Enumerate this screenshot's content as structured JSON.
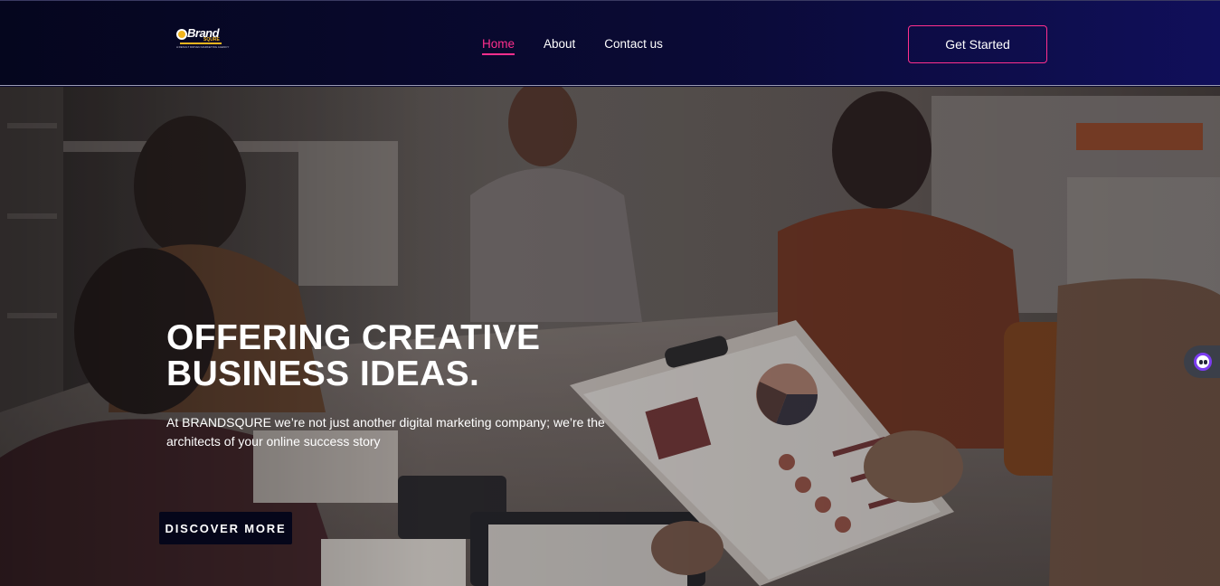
{
  "brand": {
    "name": "Brand",
    "sub": "SQURE",
    "tagline": "A RESULT DRIVEN MARKETING AGENCY"
  },
  "nav": {
    "items": [
      {
        "label": "Home",
        "active": true
      },
      {
        "label": "About",
        "active": false
      },
      {
        "label": "Contact us",
        "active": false
      }
    ],
    "cta_label": "Get Started"
  },
  "hero": {
    "title_line1": "OFFERING CREATIVE",
    "title_line2": "BUSINESS IDEAS.",
    "text": "At BRANDSQURE we’re not just another digital marketing company; we’re the architects of your online success story",
    "button_label": "DISCOVER MORE"
  },
  "colors": {
    "accent": "#ff2f8d",
    "nav_bg_start": "#05061e",
    "nav_bg_end": "#100f5a",
    "logo_gold": "#f2b51e",
    "button_dark": "#05061a"
  },
  "icons": {
    "chat_widget": "chat-bot-icon"
  }
}
